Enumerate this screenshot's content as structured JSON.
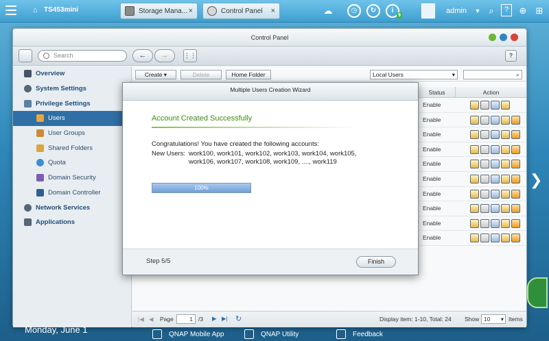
{
  "taskbar": {
    "host": "TS453mini",
    "tabs": [
      {
        "label": "Storage Mana...",
        "close": "×"
      },
      {
        "label": "Control Panel",
        "close": "×"
      }
    ],
    "notification_count": "9",
    "user": "admin",
    "help": "?"
  },
  "window": {
    "title": "Control Panel",
    "search_placeholder": "Search",
    "help": "?"
  },
  "sidebar": {
    "items": [
      {
        "label": "Overview",
        "level": "top"
      },
      {
        "label": "System Settings",
        "level": "top"
      },
      {
        "label": "Privilege Settings",
        "level": "top"
      },
      {
        "label": "Users",
        "level": "sub",
        "active": true
      },
      {
        "label": "User Groups",
        "level": "sub"
      },
      {
        "label": "Shared Folders",
        "level": "sub"
      },
      {
        "label": "Quota",
        "level": "sub"
      },
      {
        "label": "Domain Security",
        "level": "sub"
      },
      {
        "label": "Domain Controller",
        "level": "sub"
      },
      {
        "label": "Network Services",
        "level": "top"
      },
      {
        "label": "Applications",
        "level": "top"
      }
    ]
  },
  "content": {
    "create": "Create",
    "delete": "Delete",
    "home_folder": "Home Folder",
    "user_scope": "Local Users",
    "columns": {
      "status": "Status",
      "action": "Action"
    },
    "rows": [
      "Enable",
      "Enable",
      "Enable",
      "Enable",
      "Enable",
      "Enable",
      "Enable",
      "Enable",
      "Enable",
      "Enable"
    ]
  },
  "pager": {
    "page_label": "Page",
    "page": "1",
    "total_pages": "/3",
    "display": "Display item: 1-10, Total: 24",
    "show_label": "Show",
    "show_value": "10",
    "items_label": "Items"
  },
  "wizard": {
    "title": "Multiple Users Creation Wizard",
    "heading": "Account Created Successfully",
    "message": "Congratulations! You have created the following accounts:",
    "new_users_label": "New Users:",
    "users_line1": "work100, work101, work102, work103, work104, work105,",
    "users_line2": "work106, work107, work108, work109, ...., work119",
    "progress": {
      "percent": 100,
      "label": "100%"
    },
    "step": "Step 5/5",
    "finish": "Finish"
  },
  "desktop": {
    "date": "Monday, June 1",
    "dock": [
      "QNAP Mobile App",
      "QNAP Utility",
      "Feedback"
    ]
  },
  "colors": {
    "taskbar": "#3f9fd0",
    "active_item": "#2f6fa5",
    "heading_green": "#3f8a13",
    "progress_blue": "#6f9fd8"
  }
}
